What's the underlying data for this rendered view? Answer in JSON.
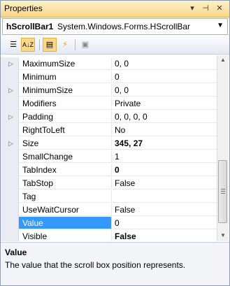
{
  "window": {
    "title": "Properties",
    "pin_glyph": "▾",
    "autohide_glyph": "⊣",
    "close_glyph": "✕"
  },
  "object_selector": {
    "name": "hScrollBar1",
    "type": "System.Windows.Forms.HScrollBar",
    "dropdown_glyph": "▼"
  },
  "toolbar": {
    "categorized_icon": "categorized-icon",
    "alphabetical_icon": "alphabetical-icon",
    "properties_icon": "properties-icon",
    "events_icon": "events-icon",
    "property_pages_icon": "property-pages-icon",
    "alphabetical_label": "A↓Z",
    "categorized_glyph": "☰",
    "properties_glyph": "▤",
    "events_glyph": "⚡",
    "property_pages_glyph": "▣"
  },
  "rows": [
    {
      "name": "MaximumSize",
      "value": "0, 0",
      "expandable": true,
      "bold": false,
      "selected": false
    },
    {
      "name": "Minimum",
      "value": "0",
      "expandable": false,
      "bold": false,
      "selected": false
    },
    {
      "name": "MinimumSize",
      "value": "0, 0",
      "expandable": true,
      "bold": false,
      "selected": false
    },
    {
      "name": "Modifiers",
      "value": "Private",
      "expandable": false,
      "bold": false,
      "selected": false
    },
    {
      "name": "Padding",
      "value": "0, 0, 0, 0",
      "expandable": true,
      "bold": false,
      "selected": false
    },
    {
      "name": "RightToLeft",
      "value": "No",
      "expandable": false,
      "bold": false,
      "selected": false
    },
    {
      "name": "Size",
      "value": "345, 27",
      "expandable": true,
      "bold": true,
      "selected": false
    },
    {
      "name": "SmallChange",
      "value": "1",
      "expandable": false,
      "bold": false,
      "selected": false
    },
    {
      "name": "TabIndex",
      "value": "0",
      "expandable": false,
      "bold": true,
      "selected": false
    },
    {
      "name": "TabStop",
      "value": "False",
      "expandable": false,
      "bold": false,
      "selected": false
    },
    {
      "name": "Tag",
      "value": "",
      "expandable": false,
      "bold": false,
      "selected": false
    },
    {
      "name": "UseWaitCursor",
      "value": "False",
      "expandable": false,
      "bold": false,
      "selected": false
    },
    {
      "name": "Value",
      "value": "0",
      "expandable": false,
      "bold": false,
      "selected": true
    },
    {
      "name": "Visible",
      "value": "False",
      "expandable": false,
      "bold": true,
      "selected": false
    }
  ],
  "expander_glyph": "▷",
  "scrollbar": {
    "up_glyph": "▲",
    "down_glyph": "▼"
  },
  "description": {
    "title": "Value",
    "text": "The value that the scroll box position represents."
  },
  "colors": {
    "selection": "#3399ff",
    "title_bar": "#f7d58a"
  }
}
